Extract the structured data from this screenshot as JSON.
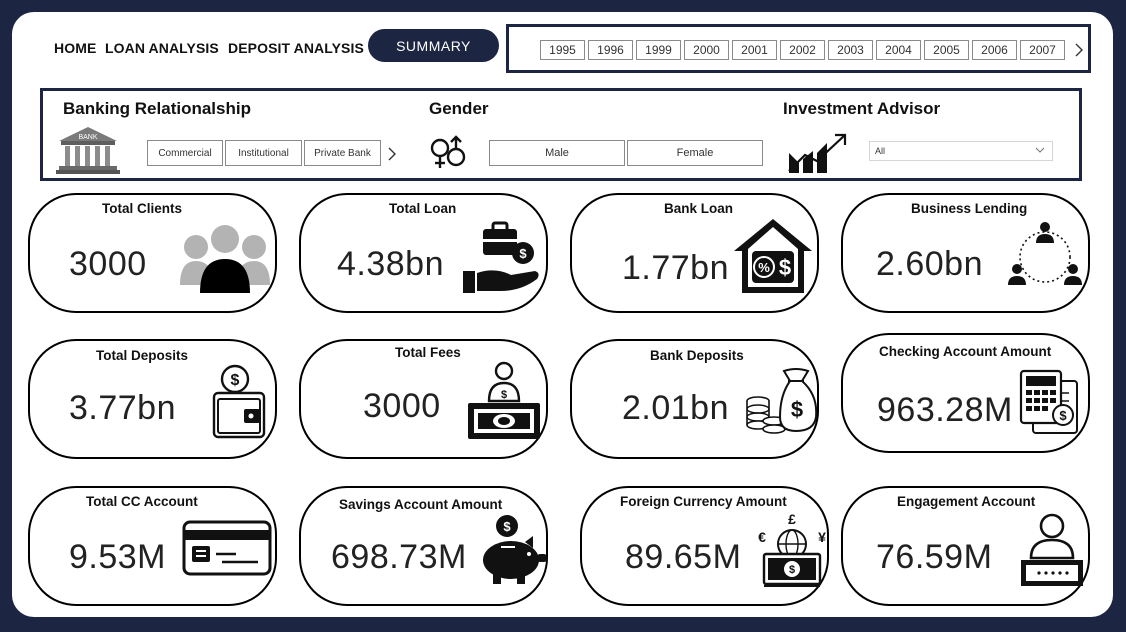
{
  "theme": {
    "frame": "#1c2541",
    "accent": "#1c2541",
    "text": "#111111"
  },
  "nav": {
    "home": "HOME",
    "loan_analysis": "LOAN ANALYSIS",
    "deposit_analysis": "DEPOSIT ANALYSIS",
    "summary": "SUMMARY"
  },
  "years": [
    "1995",
    "1996",
    "1999",
    "2000",
    "2001",
    "2002",
    "2003",
    "2004",
    "2005",
    "2006",
    "2007"
  ],
  "filters": {
    "banking_relationship": {
      "title": "Banking Relationalship",
      "options": [
        "Commercial",
        "Institutional",
        "Private Bank"
      ],
      "icon": "bank-icon"
    },
    "gender": {
      "title": "Gender",
      "options": [
        "Male",
        "Female"
      ],
      "icon": "gender-icon"
    },
    "investment_advisor": {
      "title": "Investment Advisor",
      "selected": "All",
      "icon": "growth-chart-icon"
    }
  },
  "kpis": [
    {
      "title": "Total Clients",
      "value": "3000",
      "icon": "clients-icon"
    },
    {
      "title": "Total Loan",
      "value": "4.38bn",
      "icon": "loan-hand-icon"
    },
    {
      "title": "Bank Loan",
      "value": "1.77bn",
      "icon": "house-percent-icon"
    },
    {
      "title": "Business Lending",
      "value": "2.60bn",
      "icon": "network-people-icon"
    },
    {
      "title": "Total Deposits",
      "value": "3.77bn",
      "icon": "wallet-icon"
    },
    {
      "title": "Total Fees",
      "value": "3000",
      "icon": "cash-person-icon"
    },
    {
      "title": "Bank Deposits",
      "value": "2.01bn",
      "icon": "coins-bag-icon"
    },
    {
      "title": "Checking Account Amount",
      "value": "963.28M",
      "icon": "calculator-icon"
    },
    {
      "title": "Total CC Account",
      "value": "9.53M",
      "icon": "credit-card-icon"
    },
    {
      "title": "Savings Account Amount",
      "value": "698.73M",
      "icon": "piggy-bank-icon"
    },
    {
      "title": "Foreign Currency Amount",
      "value": "89.65M",
      "icon": "currency-exchange-icon"
    },
    {
      "title": "Engagement Account",
      "value": "76.59M",
      "icon": "account-user-icon"
    }
  ]
}
